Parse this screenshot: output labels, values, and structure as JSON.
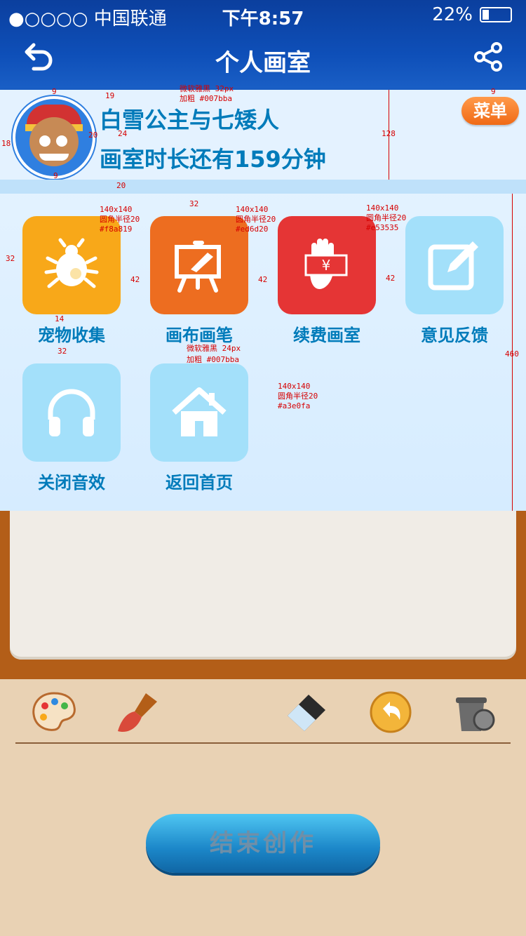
{
  "status_bar": {
    "carrier": "●○○○○ 中国联通",
    "time": "下午8:57",
    "battery": "22%"
  },
  "nav": {
    "title": "个人画室",
    "back_icon": "back-arrow-icon",
    "share_icon": "share-icon"
  },
  "header": {
    "title": "白雪公主与七矮人",
    "subtitle": "画室时长还有159分钟",
    "menu_label": "菜单"
  },
  "tiles": [
    {
      "label": "宠物收集",
      "icon": "bug-icon",
      "color": "#f8a819"
    },
    {
      "label": "画布画笔",
      "icon": "easel-icon",
      "color": "#ed6d20"
    },
    {
      "label": "续费画室",
      "icon": "hand-money-icon",
      "color": "#e53535"
    },
    {
      "label": "意见反馈",
      "icon": "edit-icon",
      "color": "#a3e0fa"
    },
    {
      "label": "关闭音效",
      "icon": "headphones-icon",
      "color": "#a3e0fa"
    },
    {
      "label": "返回首页",
      "icon": "home-icon",
      "color": "#a3e0fa"
    }
  ],
  "annotations": {
    "font_title": "微软雅黑 32px",
    "font_title_color": "加粗 #007bba",
    "tile1": "140x140",
    "tile1_r": "圆角半径20",
    "tile1_c": "#f8a819",
    "tile2": "140x140",
    "tile2_r": "圆角半径20",
    "tile2_c": "#ed6d20",
    "tile3": "140x140",
    "tile3_r": "圆角半径20",
    "tile3_c": "#e53535",
    "label_font": "微软雅黑 24px",
    "label_color": "加粗 #007bba",
    "tile6": "140x140",
    "tile6_r": "圆角半径20",
    "tile6_c": "#a3e0fa",
    "d9a": "9",
    "d19": "19",
    "d20a": "20",
    "d24": "24",
    "d18": "18",
    "d9b": "9",
    "d20b": "20",
    "d128": "128",
    "d9c": "9",
    "d32a": "32",
    "d32b": "32",
    "d42a": "42",
    "d42b": "42",
    "d42c": "42",
    "d14": "14",
    "d32c": "32",
    "d460": "460"
  },
  "bottom": {
    "end_button": "结束创作"
  }
}
